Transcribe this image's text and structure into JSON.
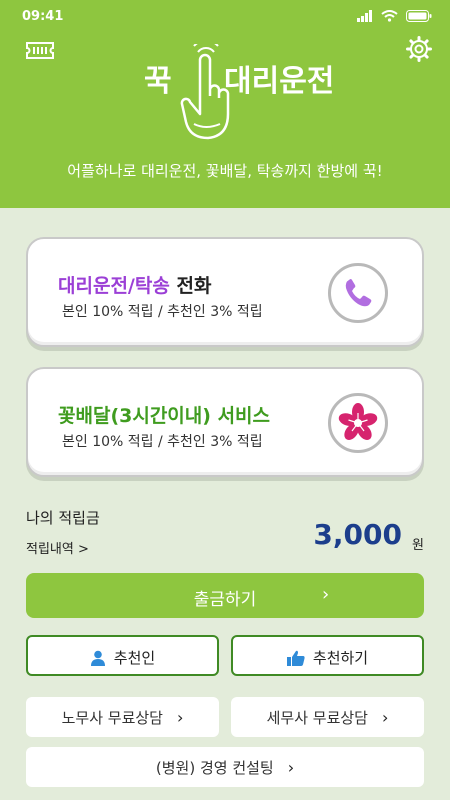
{
  "status_bar": {
    "time": "09:41"
  },
  "header": {
    "title_left": "꾹",
    "title_right": "대리운전",
    "slogan": "어플하나로 대리운전, 꽃배달, 탁송까지 한방에 꾹!"
  },
  "services": [
    {
      "title_part1": "대리운전",
      "title_sep": "/",
      "title_part2": "탁송",
      "title_part3": " 전화",
      "subtitle": "본인 10% 적립 / 추천인 3% 적립",
      "icon": "phone-icon"
    },
    {
      "title": "꽃배달(3시간이내) 서비스",
      "subtitle": "본인 10% 적립 / 추천인 3% 적립",
      "icon": "flower-icon"
    }
  ],
  "points": {
    "label": "나의 적립금",
    "history_link": "적립내역 >",
    "value": "3,000",
    "unit": "원"
  },
  "buttons": {
    "withdraw": "출금하기",
    "referrer": "추천인",
    "recommend": "추천하기",
    "labor": "노무사 무료상담",
    "tax": "세무사 무료상담",
    "consulting": "(병원) 경영 컨설팅"
  },
  "colors": {
    "brand_green": "#8ec63f",
    "accent_purple": "#9b3fd6",
    "accent_green": "#3f9c1f",
    "points_blue": "#1c3e8c",
    "flower_pink": "#d6246e"
  }
}
